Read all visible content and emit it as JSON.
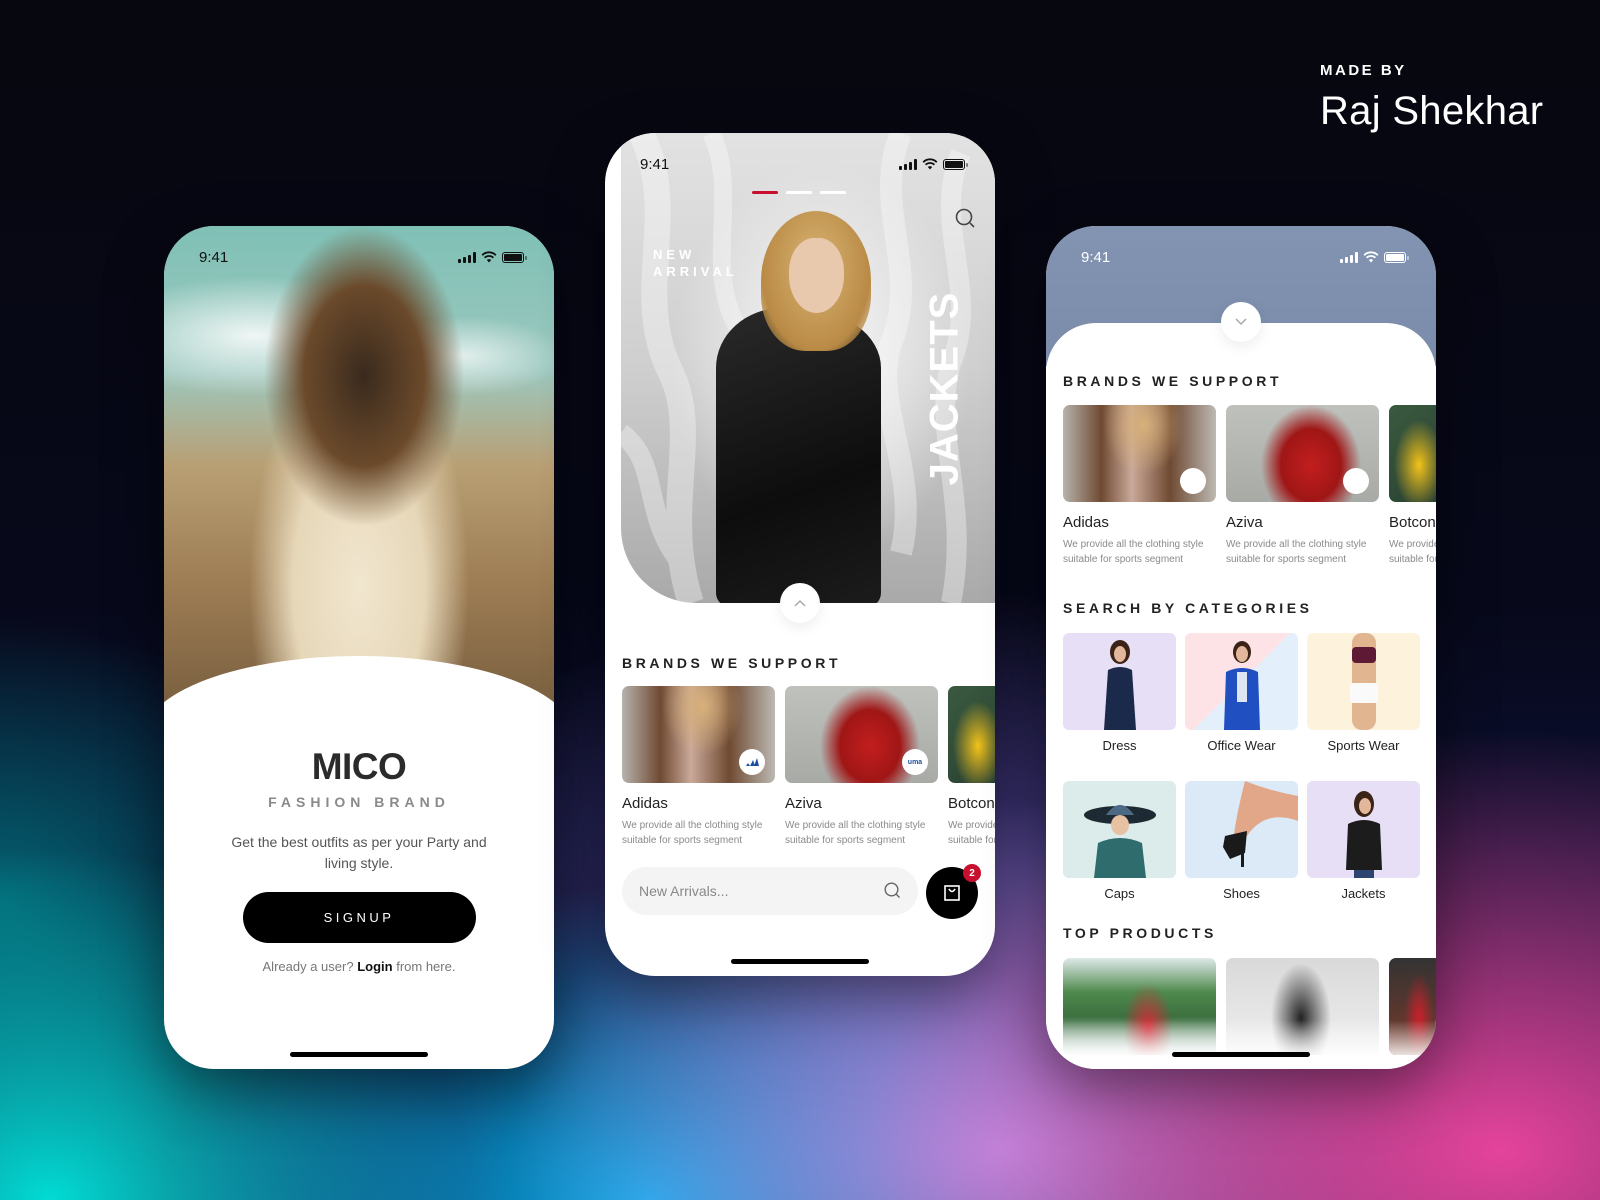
{
  "credit": {
    "made_by": "MADE BY",
    "author": "Raj Shekhar"
  },
  "status_bar": {
    "time": "9:41"
  },
  "onboarding": {
    "brand": "MICO",
    "subtitle": "FASHION BRAND",
    "tagline": "Get the best outfits as per your Party and living style.",
    "signup_label": "SIGNUP",
    "login_prefix": "Already a user?",
    "login_link": "Login",
    "login_suffix": "from here."
  },
  "home": {
    "hero_label_line1": "NEW",
    "hero_label_line2": "ARRIVAL",
    "hero_category": "JACKETS",
    "carousel": {
      "total": 3,
      "active_index": 0
    },
    "brands_title": "BRANDS WE SUPPORT",
    "brands": [
      {
        "name": "Adidas",
        "desc_line1": "We provide all the clothing style",
        "desc_line2": "suitable for sports segment",
        "logo": "adidas"
      },
      {
        "name": "Aziva",
        "desc_line1": "We provide all the clothing style",
        "desc_line2": "suitable for sports segment",
        "logo": "uma"
      },
      {
        "name": "Botcon",
        "desc_line1": "We provide all the clothing style",
        "desc_line2": "suitable for sports segment",
        "logo": ""
      }
    ],
    "search_placeholder": "New Arrivals...",
    "cart_count": "2",
    "accent_color": "#c8102e"
  },
  "browse": {
    "brands_title": "BRANDS WE SUPPORT",
    "brands": [
      {
        "name": "Adidas",
        "desc_line1": "We provide all the clothing style",
        "desc_line2": "suitable for sports segment"
      },
      {
        "name": "Aziva",
        "desc_line1": "We provide all the clothing style",
        "desc_line2": "suitable for sports segment"
      },
      {
        "name": "Botcon",
        "desc_line1": "We provide all the clothing style",
        "desc_line2": "suitable for sports segment"
      }
    ],
    "categories_title": "SEARCH BY CATEGORIES",
    "categories": [
      {
        "label": "Dress",
        "bg": "#e6dff5"
      },
      {
        "label": "Office Wear",
        "bg": "#fde3e6"
      },
      {
        "label": "Sports Wear",
        "bg": "#fdf3dc"
      },
      {
        "label": "Caps",
        "bg": "#dcecea"
      },
      {
        "label": "Shoes",
        "bg": "#dce9f7"
      },
      {
        "label": "Jackets",
        "bg": "#e6dff5"
      }
    ],
    "top_products_title": "TOP PRODUCTS"
  }
}
